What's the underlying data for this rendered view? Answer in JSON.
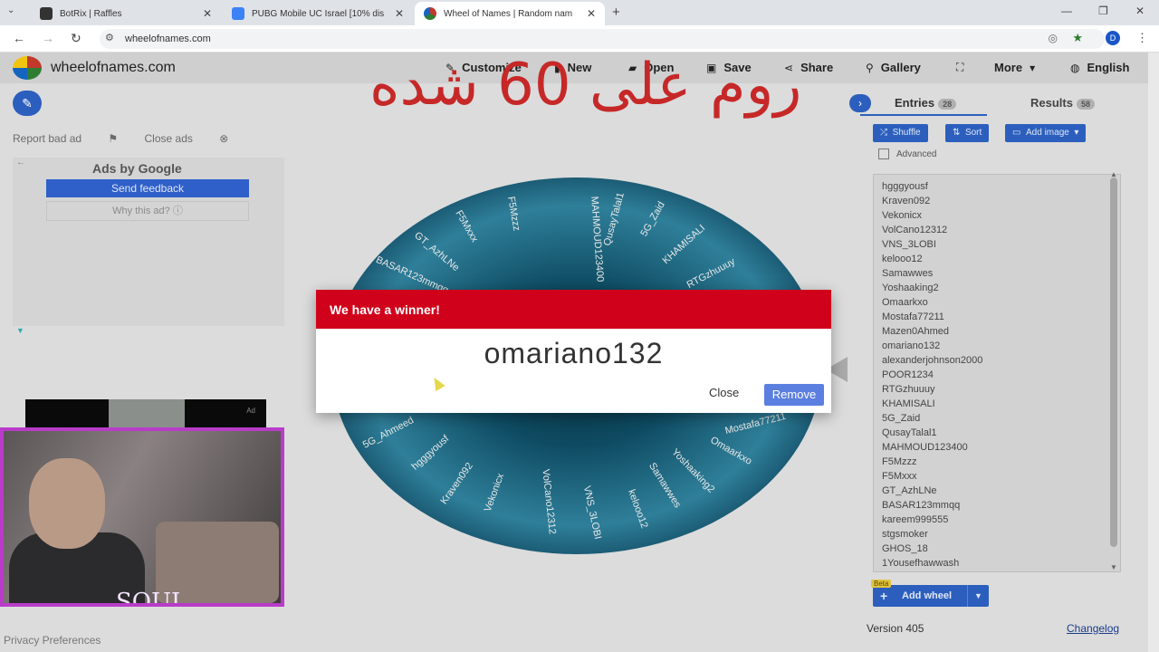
{
  "browser": {
    "tabs": [
      {
        "title": "BotRix | Raffles",
        "favicon_color": "#333333"
      },
      {
        "title": "PUBG Mobile UC Israel [10% dis",
        "favicon_color": "#3b82f6"
      },
      {
        "title": "Wheel of Names | Random nam",
        "favicon_color": "#4caf50"
      }
    ],
    "url": "wheelofnames.com",
    "profile_initial": "D"
  },
  "header": {
    "brand": "wheelofnames.com",
    "buttons": {
      "customize": "Customize",
      "new": "New",
      "open": "Open",
      "save": "Save",
      "share": "Share",
      "gallery": "Gallery",
      "more": "More",
      "language": "English"
    },
    "overlay_caption": "روم على 60 شده"
  },
  "ads": {
    "report": "Report bad ad",
    "close": "Close ads",
    "ads_by": "Ads by Google",
    "feedback": "Send feedback",
    "why": "Why this ad?",
    "ad_tag": "Ad"
  },
  "webcam": {
    "caption": "SOUL"
  },
  "footer": {
    "privacy": "Privacy Preferences"
  },
  "panel": {
    "entries_tab": "Entries",
    "entries_count": "28",
    "results_tab": "Results",
    "results_count": "58",
    "shuffle": "Shuffle",
    "sort": "Sort",
    "add_image": "Add image",
    "advanced": "Advanced",
    "entries": [
      "hgggyousf",
      "Kraven092",
      "Vekonicx",
      "VolCano12312",
      "VNS_3LOBI",
      "kelooo12",
      "Samawwes",
      "Yoshaaking2",
      "Omaarkxo",
      "Mostafa77211",
      "Mazen0Ahmed",
      "omariano132",
      "alexanderjohnson2000",
      "POOR1234",
      "RTGzhuuuy",
      "KHAMISALI",
      "5G_Zaid",
      "QusayTalal1",
      "MAHMOUD123400",
      "F5Mzzz",
      "F5Mxxx",
      "GT_AzhLNe",
      "BASAR123mmqq",
      "kareem999555",
      "stgsmoker",
      "GHOS_18",
      "1Yousefhawwash"
    ],
    "add_wheel": "Add wheel",
    "beta": "Beta",
    "version": "Version 405",
    "changelog": "Changelog"
  },
  "wheel_labels": [
    "F5Mzzz",
    "MAHMOUD123400",
    "QusayTalal1",
    "5G_Zaid",
    "KHAMISALI",
    "RTGzhuuuy",
    "POOR1234",
    "F5Mxxx",
    "GT_AzhLNe",
    "BASAR123mmqq",
    "Mostafa77211",
    "Omaarkxo",
    "Yoshaaking2",
    "Samawwes",
    "kelooo12",
    "VNS_3LOBI",
    "VolCano12312",
    "Vekonicx",
    "Kraven092",
    "hgggyousf",
    "5G_Ahmeed"
  ],
  "modal": {
    "title": "We have a winner!",
    "winner": "omariano132",
    "close": "Close",
    "remove": "Remove",
    "header_color": "#d0021b"
  }
}
